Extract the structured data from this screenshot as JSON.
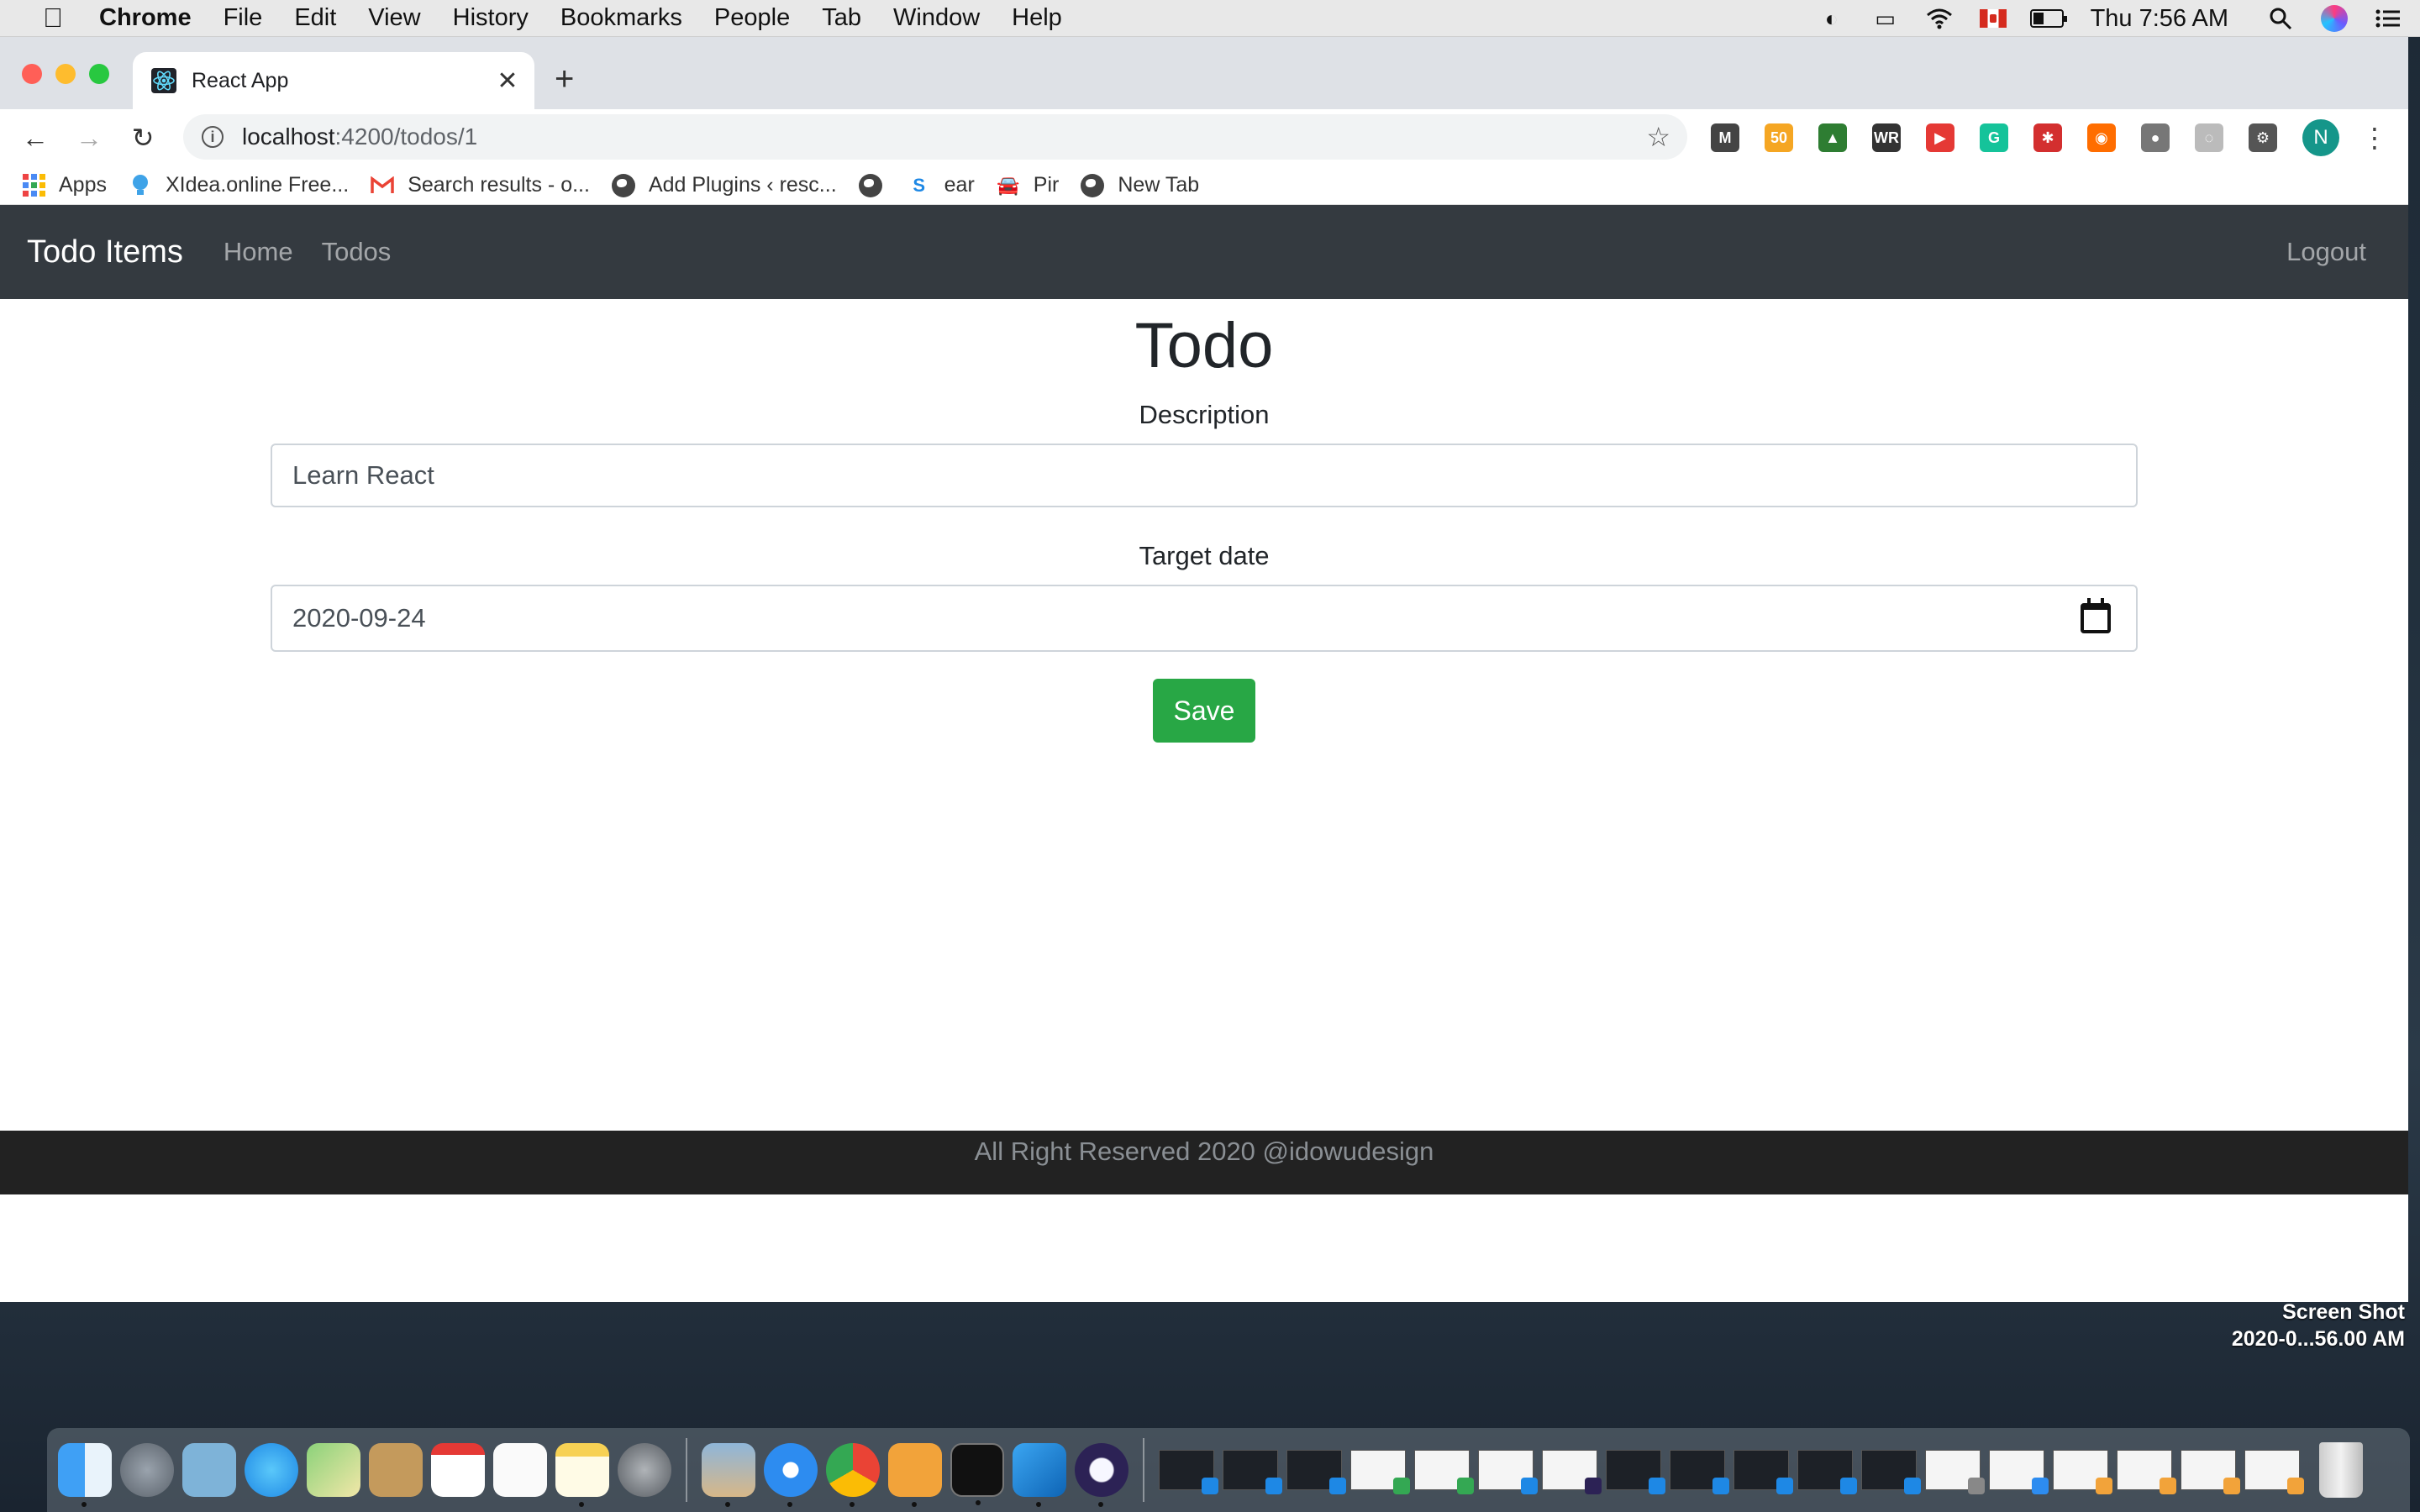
{
  "menubar": {
    "apple": "",
    "app_name": "Chrome",
    "items": [
      "File",
      "Edit",
      "View",
      "History",
      "Bookmarks",
      "People",
      "Tab",
      "Window",
      "Help"
    ],
    "clock": "Thu 7:56 AM"
  },
  "browser": {
    "tab_title": "React App",
    "tab_close": "✕",
    "new_tab": "+",
    "url_host": "localhost",
    "url_rest": ":4200/todos/1",
    "profile_initial": "N",
    "extensions": [
      {
        "label": "M",
        "color": "#444444"
      },
      {
        "label": "50",
        "color": "#f5a623"
      },
      {
        "label": "▲",
        "color": "#2e7d32"
      },
      {
        "label": "WR",
        "color": "#333333"
      },
      {
        "label": "▶",
        "color": "#e53935"
      },
      {
        "label": "G",
        "color": "#15c39a"
      },
      {
        "label": "✱",
        "color": "#d32f2f"
      },
      {
        "label": "◉",
        "color": "#ff6d00"
      },
      {
        "label": "●",
        "color": "#777777"
      },
      {
        "label": "◌",
        "color": "#bbbbbb"
      },
      {
        "label": "⚙",
        "color": "#555555"
      }
    ]
  },
  "bookmarks": {
    "apps": "Apps",
    "items": [
      "XIdea.online Free...",
      "Search results - o...",
      "Add Plugins ‹ resc...",
      "",
      "ear",
      "Pir",
      "New Tab"
    ]
  },
  "app": {
    "brand": "Todo Items",
    "nav": {
      "home": "Home",
      "todos": "Todos",
      "logout": "Logout"
    },
    "heading": "Todo",
    "description_label": "Description",
    "description_value": "Learn React",
    "target_date_label": "Target date",
    "target_date_value": "2020-09-24",
    "save_button": "Save",
    "footer": "All Right Reserved 2020 @idowudesign"
  },
  "desktop": {
    "screenshot_label_1": "Screen Shot",
    "screenshot_label_2": "2020-0...56.00 AM"
  },
  "colors": {
    "navbar": "#343a40",
    "save_button": "#28a745",
    "footer": "#222222"
  }
}
